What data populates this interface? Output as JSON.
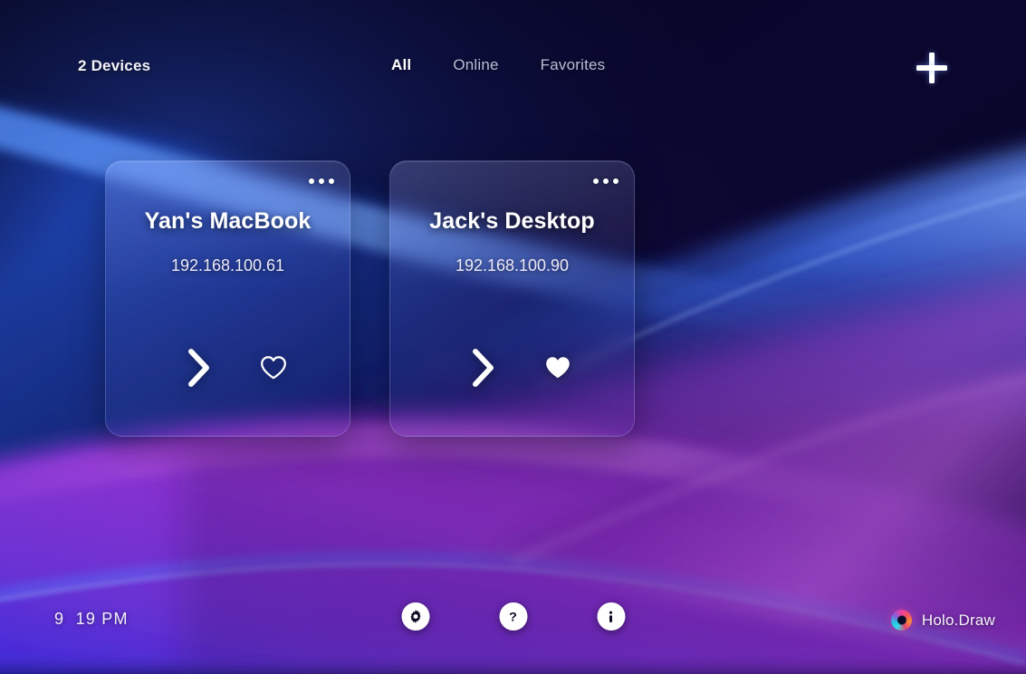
{
  "header": {
    "device_count_label": "2 Devices",
    "tabs": [
      {
        "label": "All",
        "active": true
      },
      {
        "label": "Online",
        "active": false
      },
      {
        "label": "Favorites",
        "active": false
      }
    ],
    "add_button_icon": "plus-icon"
  },
  "devices": [
    {
      "name": "Yan's MacBook",
      "ip": "192.168.100.61",
      "favorite": false,
      "menu_icon": "more-options-icon",
      "connect_icon": "chevron-right-icon",
      "favorite_icon": "heart-outline-icon"
    },
    {
      "name": "Jack's Desktop",
      "ip": "192.168.100.90",
      "favorite": true,
      "menu_icon": "more-options-icon",
      "connect_icon": "chevron-right-icon",
      "favorite_icon": "heart-filled-icon"
    }
  ],
  "footer": {
    "clock": "9  19 PM",
    "buttons": [
      {
        "icon": "gear-icon",
        "label": "Settings"
      },
      {
        "icon": "question-mark-icon",
        "label": "Help"
      },
      {
        "icon": "info-icon",
        "label": "About"
      }
    ],
    "brand_name": "Holo.Draw",
    "brand_icon": "holo-swirl-logo"
  },
  "theme": {
    "background_dark": "#04031a",
    "accent_blue": "#2f63f0",
    "accent_purple": "#8b2fd8",
    "accent_magenta": "#c44ae0",
    "text_primary": "#ffffff",
    "text_muted": "#b9bed6"
  }
}
